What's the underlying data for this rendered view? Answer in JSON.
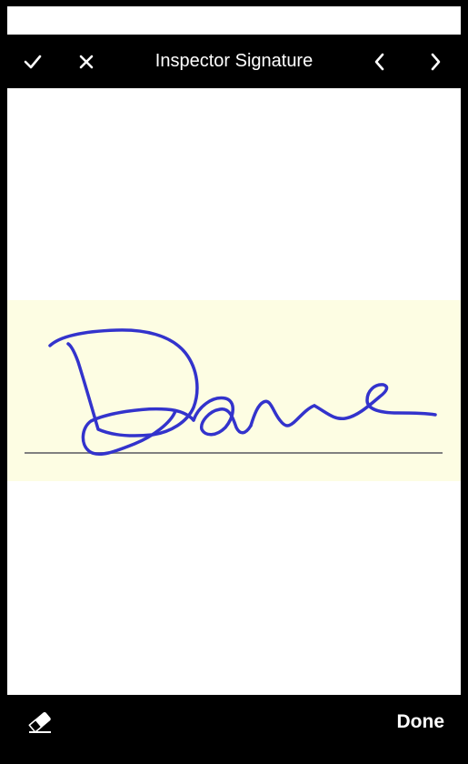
{
  "toolbar": {
    "title": "Inspector Signature",
    "accept_icon": "checkmark-icon",
    "cancel_icon": "close-icon",
    "prev_icon": "chevron-left-icon",
    "next_icon": "chevron-right-icon"
  },
  "signature": {
    "ink_color": "#3333cc",
    "band_color": "#fdfde3",
    "baseline_color": "#808080"
  },
  "bottom_bar": {
    "eraser_icon": "eraser-icon",
    "done_label": "Done"
  }
}
